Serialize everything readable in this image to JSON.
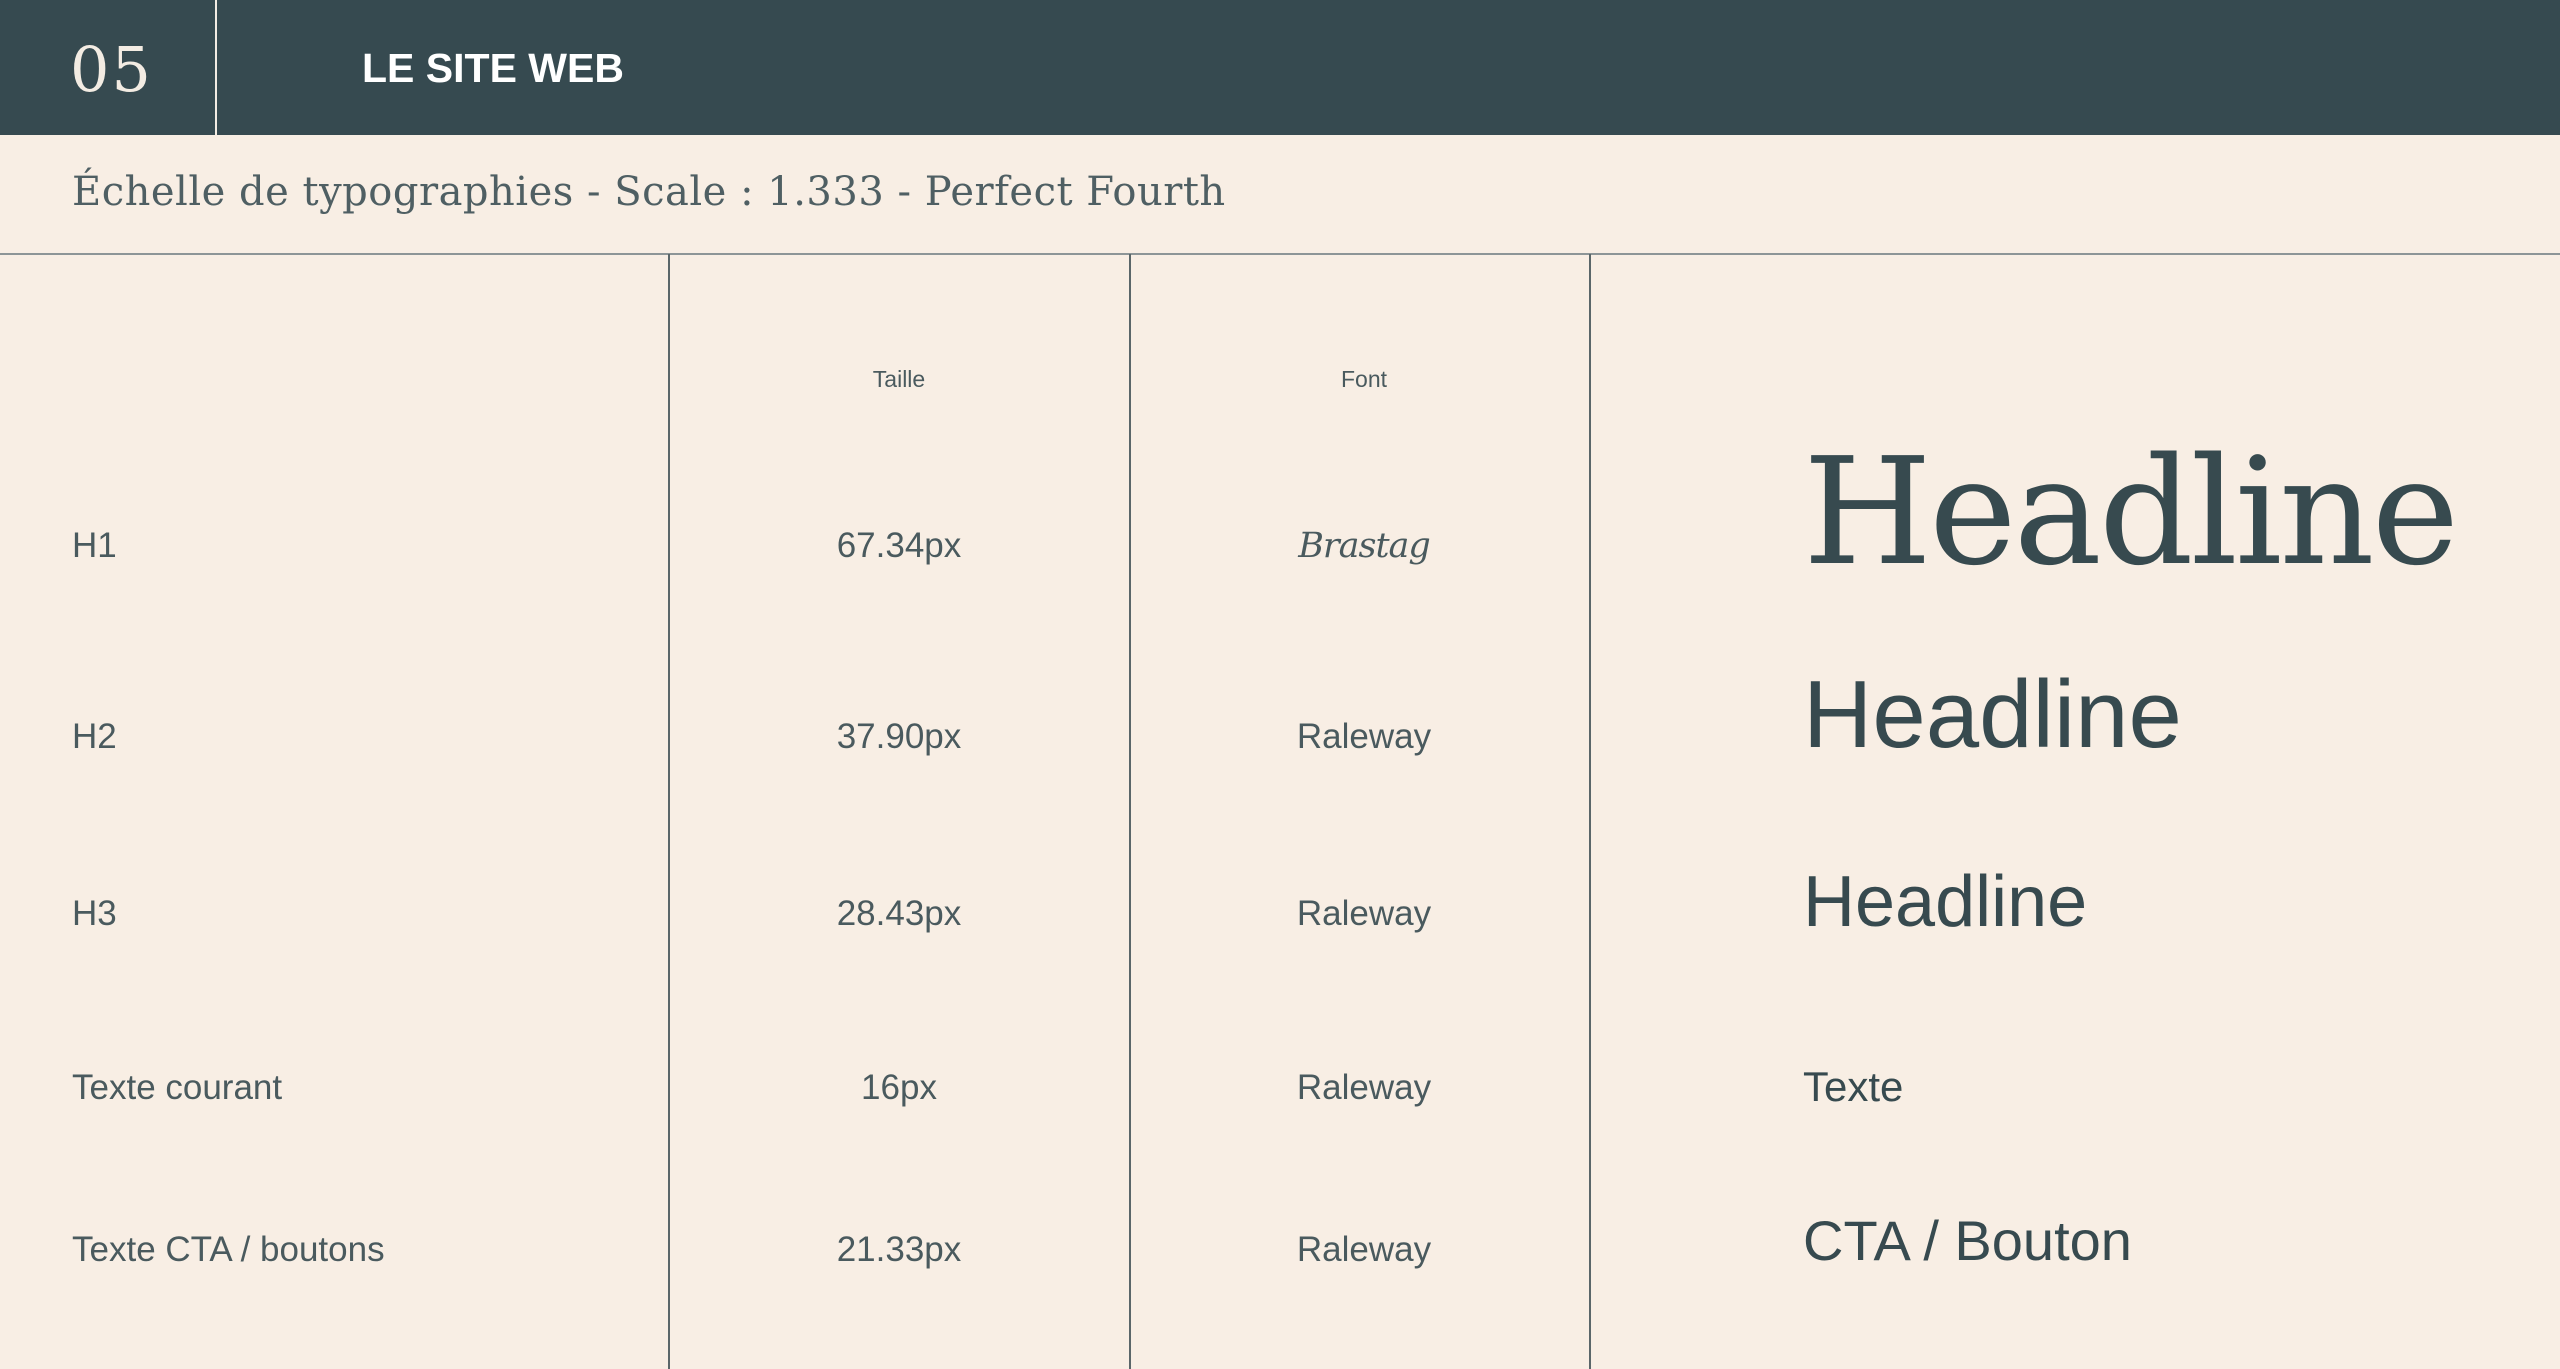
{
  "header": {
    "number": "05",
    "title": "LE SITE WEB"
  },
  "subtitle": "Échelle de typographies - Scale : 1.333 - Perfect Fourth",
  "table": {
    "columns": [
      "",
      "Taille",
      "Font",
      ""
    ],
    "rows": [
      {
        "label": "H1",
        "size": "67.34px",
        "font": "Brastag",
        "sample": "Headline"
      },
      {
        "label": "H2",
        "size": "37.90px",
        "font": "Raleway",
        "sample": "Headline"
      },
      {
        "label": "H3",
        "size": "28.43px",
        "font": "Raleway",
        "sample": "Headline"
      },
      {
        "label": "Texte courant",
        "size": "16px",
        "font": "Raleway",
        "sample": "Texte"
      },
      {
        "label": "Texte CTA / boutons",
        "size": "21.33px",
        "font": "Raleway",
        "sample": "CTA / Bouton"
      }
    ]
  },
  "colors": {
    "header_bg": "#364a50",
    "page_bg": "#f8eee4",
    "text": "#374a4f"
  }
}
